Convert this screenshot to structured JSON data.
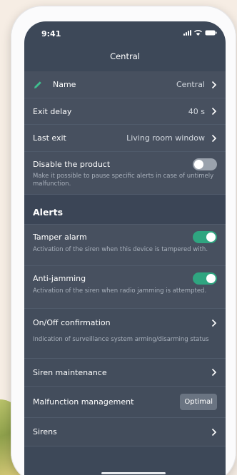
{
  "status_bar": {
    "time": "9:41"
  },
  "header": {
    "title": "Central"
  },
  "rows": {
    "name": {
      "label": "Name",
      "value": "Central"
    },
    "exit_delay": {
      "label": "Exit delay",
      "value": "40 s"
    },
    "last_exit": {
      "label": "Last exit",
      "value": "Living room window"
    },
    "disable_product": {
      "label": "Disable the product",
      "description": "Make it possible to pause specific alerts in case of untimely malfunction.",
      "enabled": false
    }
  },
  "alerts": {
    "header": "Alerts",
    "tamper": {
      "label": "Tamper alarm",
      "description": "Activation of the siren when this device is tampered with.",
      "enabled": true
    },
    "anti_jamming": {
      "label": "Anti-jamming",
      "description": "Activation of the siren when radio jamming is attempted.",
      "enabled": true
    },
    "on_off_confirmation": {
      "label": "On/Off confirmation",
      "description": "Indication of surveillance system arming/disarming status"
    },
    "siren_maintenance": {
      "label": "Siren maintenance"
    },
    "malfunction_management": {
      "label": "Malfunction management",
      "value": "Optimal"
    },
    "sirens": {
      "label": "Sirens"
    }
  },
  "colors": {
    "accent_green": "#2fa580",
    "background": "#3d4858",
    "toggle_off": "#9aa2ad"
  },
  "icons": {
    "name_row": "pencil-icon",
    "row_navigation": "chevron-right-icon"
  }
}
